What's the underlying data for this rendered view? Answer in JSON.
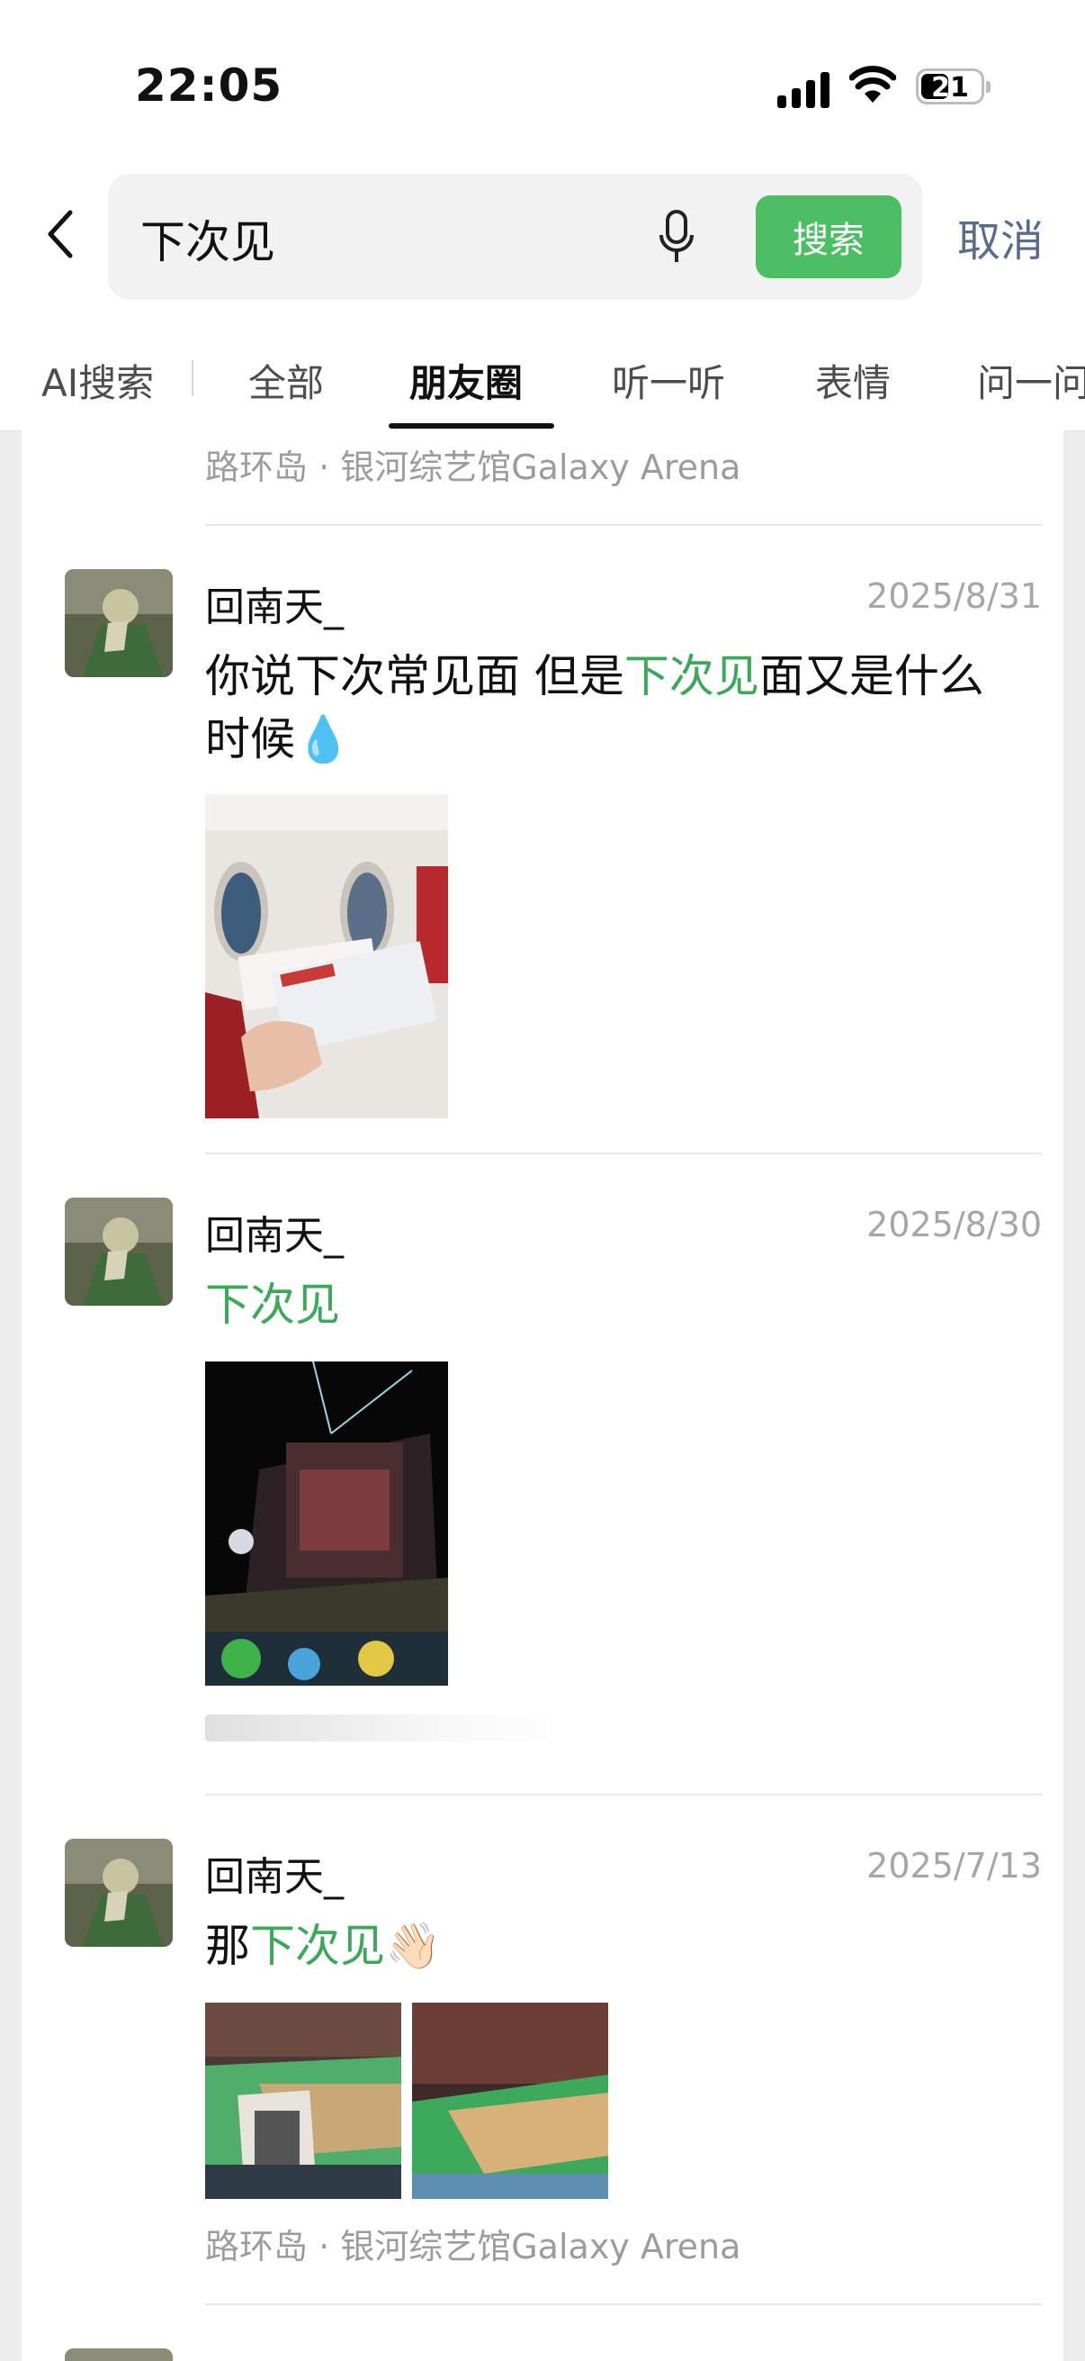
{
  "status": {
    "time": "22:05",
    "battery": "21"
  },
  "search": {
    "query": "下次见",
    "button_label": "搜索",
    "cancel_label": "取消"
  },
  "tabs": [
    "AI搜索",
    "全部",
    "朋友圈",
    "听一听",
    "表情",
    "问一问"
  ],
  "active_tab": "朋友圈",
  "colors": {
    "accent": "#4cbf64",
    "highlight": "#3aa95a",
    "cancel": "#5a6b8c"
  },
  "feed": {
    "top_location": "路环岛 · 银河综艺馆Galaxy Arena",
    "posts": [
      {
        "author": "回南天_",
        "date": "2025/8/31",
        "text_before": "你说下次常见面 但是",
        "text_match": "下次见",
        "text_after": "面又是什么时候💧",
        "photo_count": 1
      },
      {
        "author": "回南天_",
        "date": "2025/8/30",
        "text_before": "",
        "text_match": "下次见",
        "text_after": "",
        "photo_count": 1
      },
      {
        "author": "回南天_",
        "date": "2025/7/13",
        "text_before": "那",
        "text_match": "下次见",
        "text_after": "👋🏻",
        "photo_count": 2,
        "location": "路环岛 · 银河综艺馆Galaxy Arena"
      }
    ]
  }
}
